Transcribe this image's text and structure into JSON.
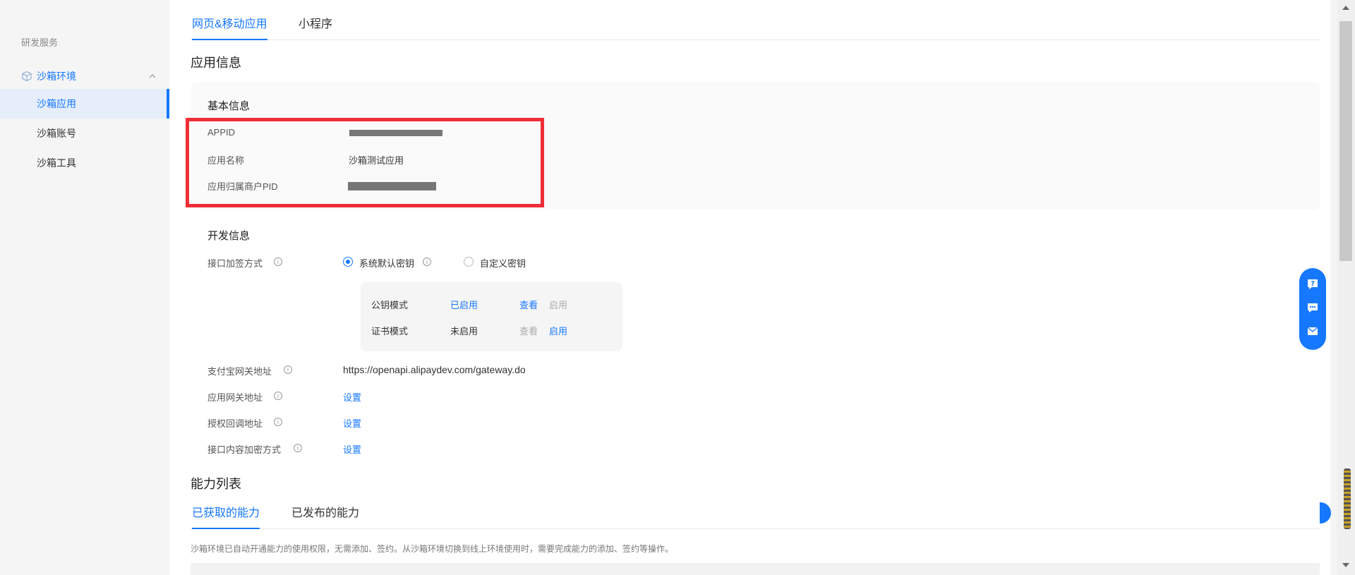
{
  "sidebar": {
    "group_title": "研发服务",
    "parent": {
      "label": "沙箱环境",
      "icon": "cube-icon",
      "expanded": true
    },
    "items": [
      {
        "label": "沙箱应用",
        "active": true
      },
      {
        "label": "沙箱账号",
        "active": false
      },
      {
        "label": "沙箱工具",
        "active": false
      }
    ]
  },
  "top_tabs": [
    {
      "label": "网页&移动应用",
      "active": true
    },
    {
      "label": "小程序",
      "active": false
    }
  ],
  "app_info": {
    "title": "应用信息",
    "basic": {
      "title": "基本信息",
      "appid_label": "APPID",
      "name_label": "应用名称",
      "name_value": "沙箱测试应用",
      "pid_label": "应用归属商户PID"
    },
    "dev": {
      "title": "开发信息",
      "sign_label": "接口加签方式",
      "sign_options": [
        {
          "label": "系统默认密钥",
          "checked": true
        },
        {
          "label": "自定义密钥",
          "checked": false
        }
      ],
      "modes": [
        {
          "name": "公钥模式",
          "status": "已启用",
          "view": "查看",
          "enable": "启用"
        },
        {
          "name": "证书模式",
          "status": "未启用",
          "view": "查看",
          "enable": "启用"
        }
      ],
      "gateway_label": "支付宝网关地址",
      "gateway_value": "https://openapi.alipaydev.com/gateway.do",
      "app_gateway_label": "应用网关地址",
      "app_gateway_action": "设置",
      "callback_label": "授权回调地址",
      "callback_action": "设置",
      "encrypt_label": "接口内容加密方式",
      "encrypt_action": "设置"
    }
  },
  "capability": {
    "title": "能力列表",
    "tabs": [
      {
        "label": "已获取的能力",
        "active": true
      },
      {
        "label": "已发布的能力",
        "active": false
      }
    ],
    "description": "沙箱环境已自动开通能力的使用权限，无需添加、签约。从沙箱环境切换到线上环境使用时，需要完成能力的添加、签约等操作。"
  },
  "float_widget": {
    "icons": [
      "help-icon",
      "chat-icon",
      "mail-icon"
    ]
  },
  "colors": {
    "accent": "#1677ff",
    "highlight": "#ee2e36"
  }
}
